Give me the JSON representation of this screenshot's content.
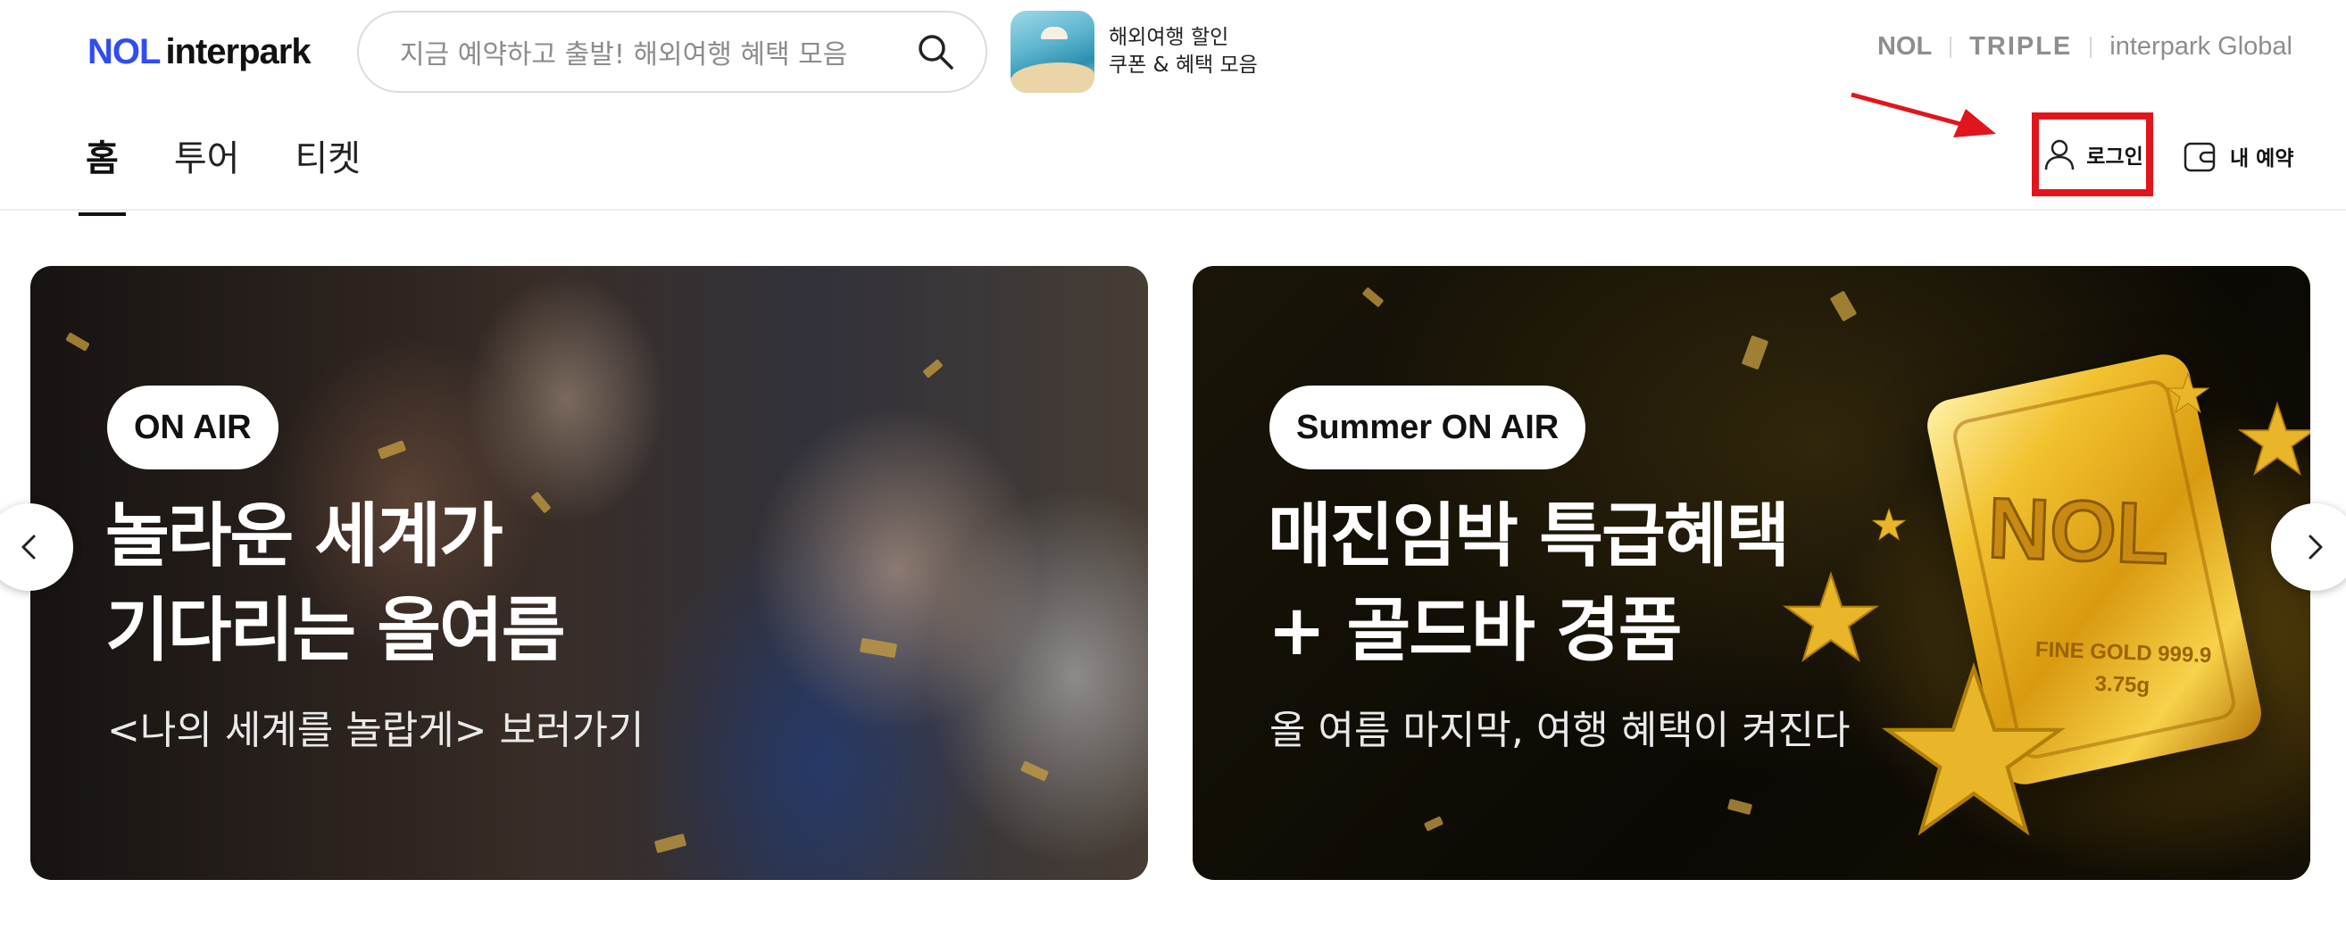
{
  "header": {
    "logo": {
      "nol": "NOL",
      "name": "interpark"
    },
    "search": {
      "placeholder": "지금 예약하고 출발! 해외여행 혜택 모음",
      "icon": "search-icon"
    },
    "promo": {
      "line1": "해외여행 할인",
      "line2": "쿠폰 & 혜택 모음"
    },
    "brand_links": [
      "NOL",
      "TRIPLE",
      "interpark Global"
    ],
    "tabs": [
      {
        "label": "홈",
        "active": true
      },
      {
        "label": "투어",
        "active": false
      },
      {
        "label": "티켓",
        "active": false
      }
    ],
    "login_label": "로그인",
    "reservation_label": "내 예약"
  },
  "banners": [
    {
      "badge": "ON AIR",
      "title_line1": "놀라운 세계가",
      "title_line2": "기다리는 올여름",
      "subtitle": "<나의 세계를 놀랍게> 보러가기"
    },
    {
      "badge": "Summer ON AIR",
      "title_line1": "매진임박 특급혜택",
      "title_line2": "+ 골드바 경품",
      "subtitle": "올 여름 마지막, 여행 혜택이 켜진다",
      "gold_bar": {
        "mark": "NOL",
        "line1": "FINE GOLD 999.9",
        "line2": "3.75g"
      }
    }
  ],
  "colors": {
    "brand_blue": "#2f4cf5",
    "annotation_red": "#e0161c",
    "gold": "#f2c230"
  }
}
